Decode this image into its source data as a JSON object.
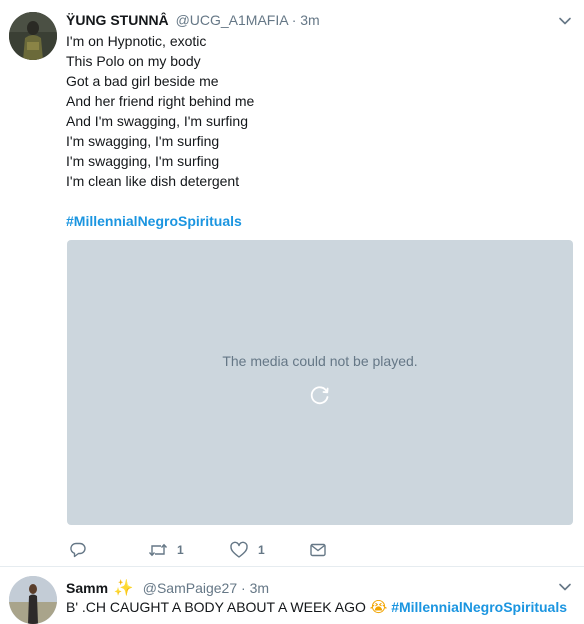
{
  "tweet1": {
    "author": {
      "name": "ŸUNG STUNNÂ",
      "handle": "@UCG_A1MAFIA",
      "dot": "·",
      "time": "3m"
    },
    "lines": [
      "I'm on Hypnotic, exotic",
      "This Polo on my body",
      "Got a bad girl beside me",
      "And her friend right behind me",
      "And I'm swagging, I'm surfing",
      "I'm swagging, I'm surfing",
      "I'm swagging, I'm surfing",
      "I'm clean like dish detergent"
    ],
    "hashtag": "#MillennialNegroSpirituals",
    "media": {
      "message": "The media could not be played."
    },
    "actions": {
      "retweet_count": "1",
      "like_count": "1"
    }
  },
  "tweet2": {
    "author": {
      "name": "Samm",
      "emoji": "✨",
      "handle": "@SamPaige27",
      "dot": "·",
      "time": "3m"
    },
    "text": "B' .CH CAUGHT A BODY ABOUT A WEEK AGO",
    "emoji": "😭",
    "hashtag": "#MillennialNegroSpirituals"
  },
  "colors": {
    "link": "#1b95e0",
    "muted": "#657786",
    "media_bg": "#ccd6dd"
  },
  "icons": [
    "chevron-down-icon",
    "reply-icon",
    "retweet-icon",
    "heart-icon",
    "message-icon",
    "spinner-icon",
    "sparkles-icon",
    "crying-face-icon"
  ]
}
